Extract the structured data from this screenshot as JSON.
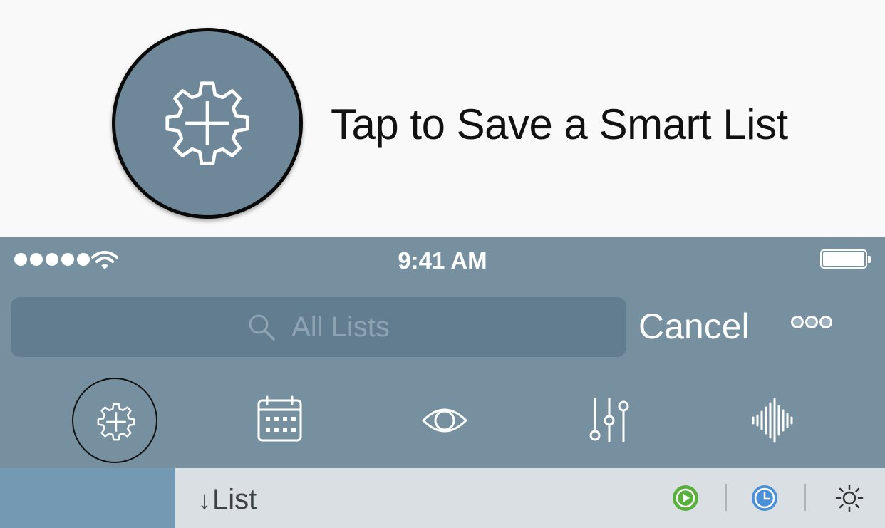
{
  "tip": {
    "text": "Tap to Save a Smart List"
  },
  "status_bar": {
    "time": "9:41 AM",
    "signal_bars": 5
  },
  "search": {
    "placeholder": "All Lists"
  },
  "header": {
    "cancel_label": "Cancel"
  },
  "toolbar": {
    "tools": [
      {
        "name": "save-smart-list",
        "icon": "gear-plus-icon",
        "selected": true
      },
      {
        "name": "calendar",
        "icon": "calendar-icon"
      },
      {
        "name": "eye",
        "icon": "eye-icon"
      },
      {
        "name": "filters",
        "icon": "sliders-icon"
      },
      {
        "name": "audio",
        "icon": "waveform-icon"
      }
    ]
  },
  "list_bar": {
    "sort_arrow": "↓",
    "label": "List",
    "icons": [
      "play-icon",
      "clock-icon",
      "brightness-icon"
    ]
  },
  "colors": {
    "panel": "#7690a0",
    "search_field": "#627d8f",
    "play_green": "#5ab03c",
    "clock_blue": "#4a90d9",
    "sidebar_blue": "#7499b3"
  }
}
